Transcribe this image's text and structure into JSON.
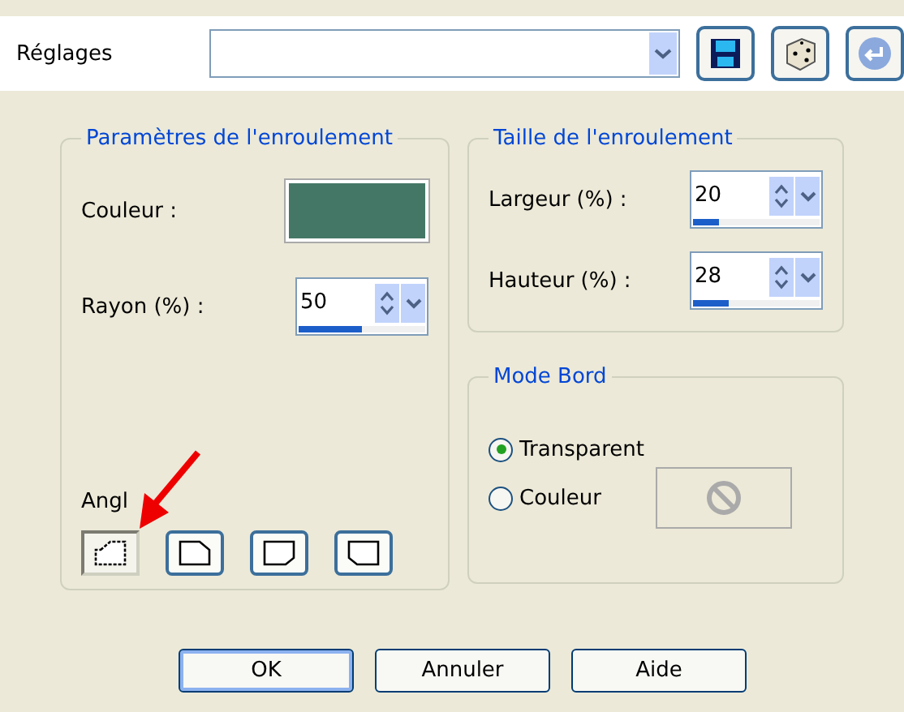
{
  "presets": {
    "label": "Réglages"
  },
  "curl_params": {
    "title": "Paramètres de l'enroulement",
    "color_label": "Couleur :",
    "color": "#447766",
    "radius": {
      "label": "Rayon (%) :",
      "value": "50",
      "level": 0.5
    },
    "angle_label": "Angl",
    "corners": [
      {
        "kind": "top-left",
        "selected": true
      },
      {
        "kind": "top-right",
        "selected": false
      },
      {
        "kind": "bottom-right",
        "selected": false
      },
      {
        "kind": "bottom-left",
        "selected": false
      }
    ]
  },
  "curl_size": {
    "title": "Taille de l'enroulement",
    "fields": [
      {
        "label": "Largeur (%) :",
        "value": "20",
        "level": 0.2
      },
      {
        "label": "Hauteur (%) :",
        "value": "28",
        "level": 0.28
      }
    ]
  },
  "edge_mode": {
    "title": "Mode Bord",
    "options": [
      {
        "label": "Transparent",
        "selected": true
      },
      {
        "label": "Couleur",
        "selected": false
      }
    ]
  },
  "buttons": [
    {
      "label": "OK",
      "default": true
    },
    {
      "label": "Annuler",
      "default": false
    },
    {
      "label": "Aide",
      "default": false
    }
  ]
}
